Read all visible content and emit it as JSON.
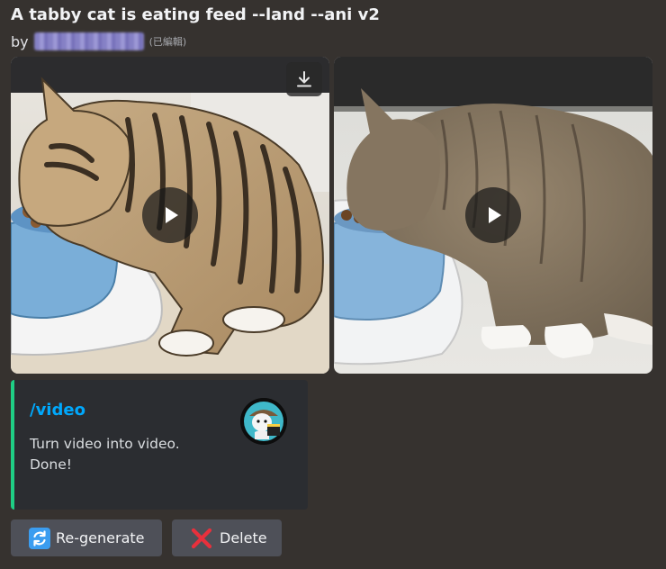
{
  "message": {
    "title": "A tabby cat is eating feed --land --ani v2",
    "by_prefix": "by",
    "edited_label": "(已編輯)"
  },
  "attachments": [
    {
      "style": "anime illustration",
      "subject": "tabby cat eating from blue bowl"
    },
    {
      "style": "realistic video frame",
      "subject": "tabby cat eating from blue bowl"
    }
  ],
  "embed": {
    "title": "/video",
    "line1": "Turn video into video.",
    "line2": "Done!",
    "accent_color": "#1fce85"
  },
  "buttons": {
    "regenerate_label": "Re-generate",
    "regenerate_icon": "arrows-clockwise-icon",
    "delete_label": "Delete",
    "delete_icon": "cross-mark-icon"
  },
  "colors": {
    "background": "#36322f",
    "embed_bg": "#2b2d31",
    "link": "#00a8fc",
    "button_bg": "#4e5058"
  }
}
